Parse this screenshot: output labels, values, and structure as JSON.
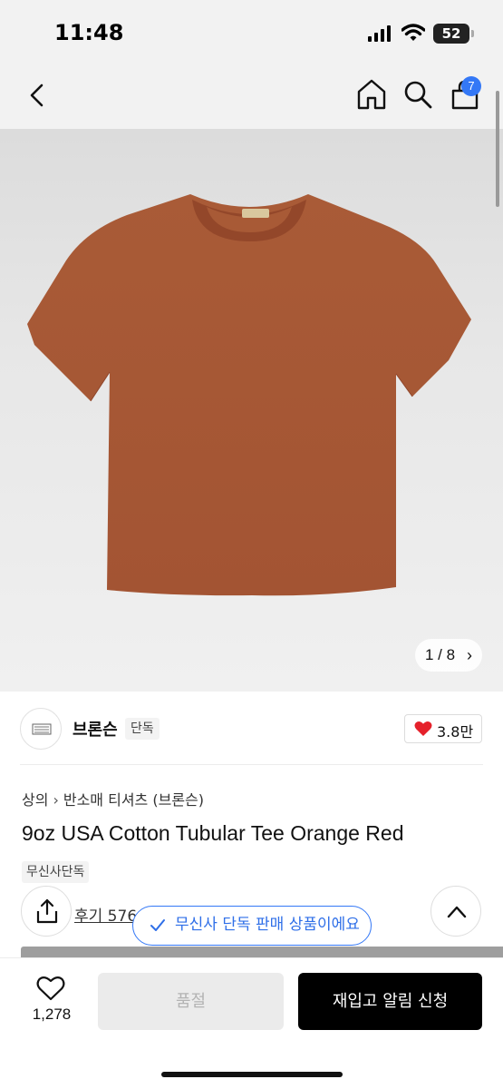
{
  "status_bar": {
    "time": "11:48",
    "battery": "52",
    "icons": [
      "signal-icon",
      "wifi-icon",
      "battery-icon"
    ]
  },
  "nav": {
    "icons": [
      "back-icon",
      "home-icon",
      "search-icon",
      "cart-icon"
    ],
    "cart_badge": "7"
  },
  "gallery": {
    "counter_text": "1 / 8",
    "counter_chevron": "›"
  },
  "brand": {
    "name": "브론슨",
    "tag": "단독",
    "like_count": "3.8만"
  },
  "breadcrumb": {
    "items": [
      "상의",
      "반소매 티셔츠 (브론슨)"
    ],
    "separator": "›"
  },
  "product": {
    "title": "9oz USA Cotton Tubular Tee Orange Red",
    "exclusive_tag": "무신사단독",
    "review_text": "후기 576"
  },
  "toast": {
    "text": "무신사 단독 판매 상품이에요"
  },
  "bottom_bar": {
    "wish_count": "1,278",
    "soldout_label": "품절",
    "restock_label": "재입고 알림 신청"
  },
  "colors": {
    "accent": "#3478f6",
    "tshirt": "#a85a36",
    "heart": "#e5212b"
  }
}
